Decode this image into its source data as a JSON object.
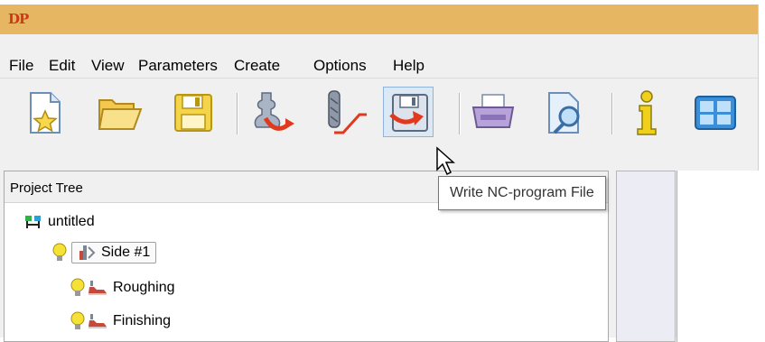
{
  "app": {
    "logo_text": "DP",
    "title_color": "#e6b662",
    "logo_color": "#d2371b"
  },
  "menu": {
    "items": [
      {
        "label": "File"
      },
      {
        "label": "Edit"
      },
      {
        "label": "View"
      },
      {
        "label": "Parameters"
      },
      {
        "label": "Create"
      },
      {
        "label": "Options"
      },
      {
        "label": "Help"
      }
    ]
  },
  "toolbar": {
    "buttons": [
      {
        "icon": "new-project-icon"
      },
      {
        "icon": "open-folder-icon"
      },
      {
        "icon": "save-icon"
      },
      {
        "icon": "turn-part-export-icon"
      },
      {
        "icon": "tool-path-icon"
      },
      {
        "icon": "write-nc-program-icon",
        "pressed": true
      },
      {
        "icon": "print-icon"
      },
      {
        "icon": "print-preview-icon"
      },
      {
        "icon": "info-icon"
      },
      {
        "icon": "window-layout-icon"
      }
    ]
  },
  "tooltip": {
    "text": "Write NC-program File"
  },
  "tree": {
    "title": "Project Tree",
    "root": "untitled",
    "side": "Side #1",
    "ops": [
      "Roughing",
      "Finishing"
    ]
  }
}
